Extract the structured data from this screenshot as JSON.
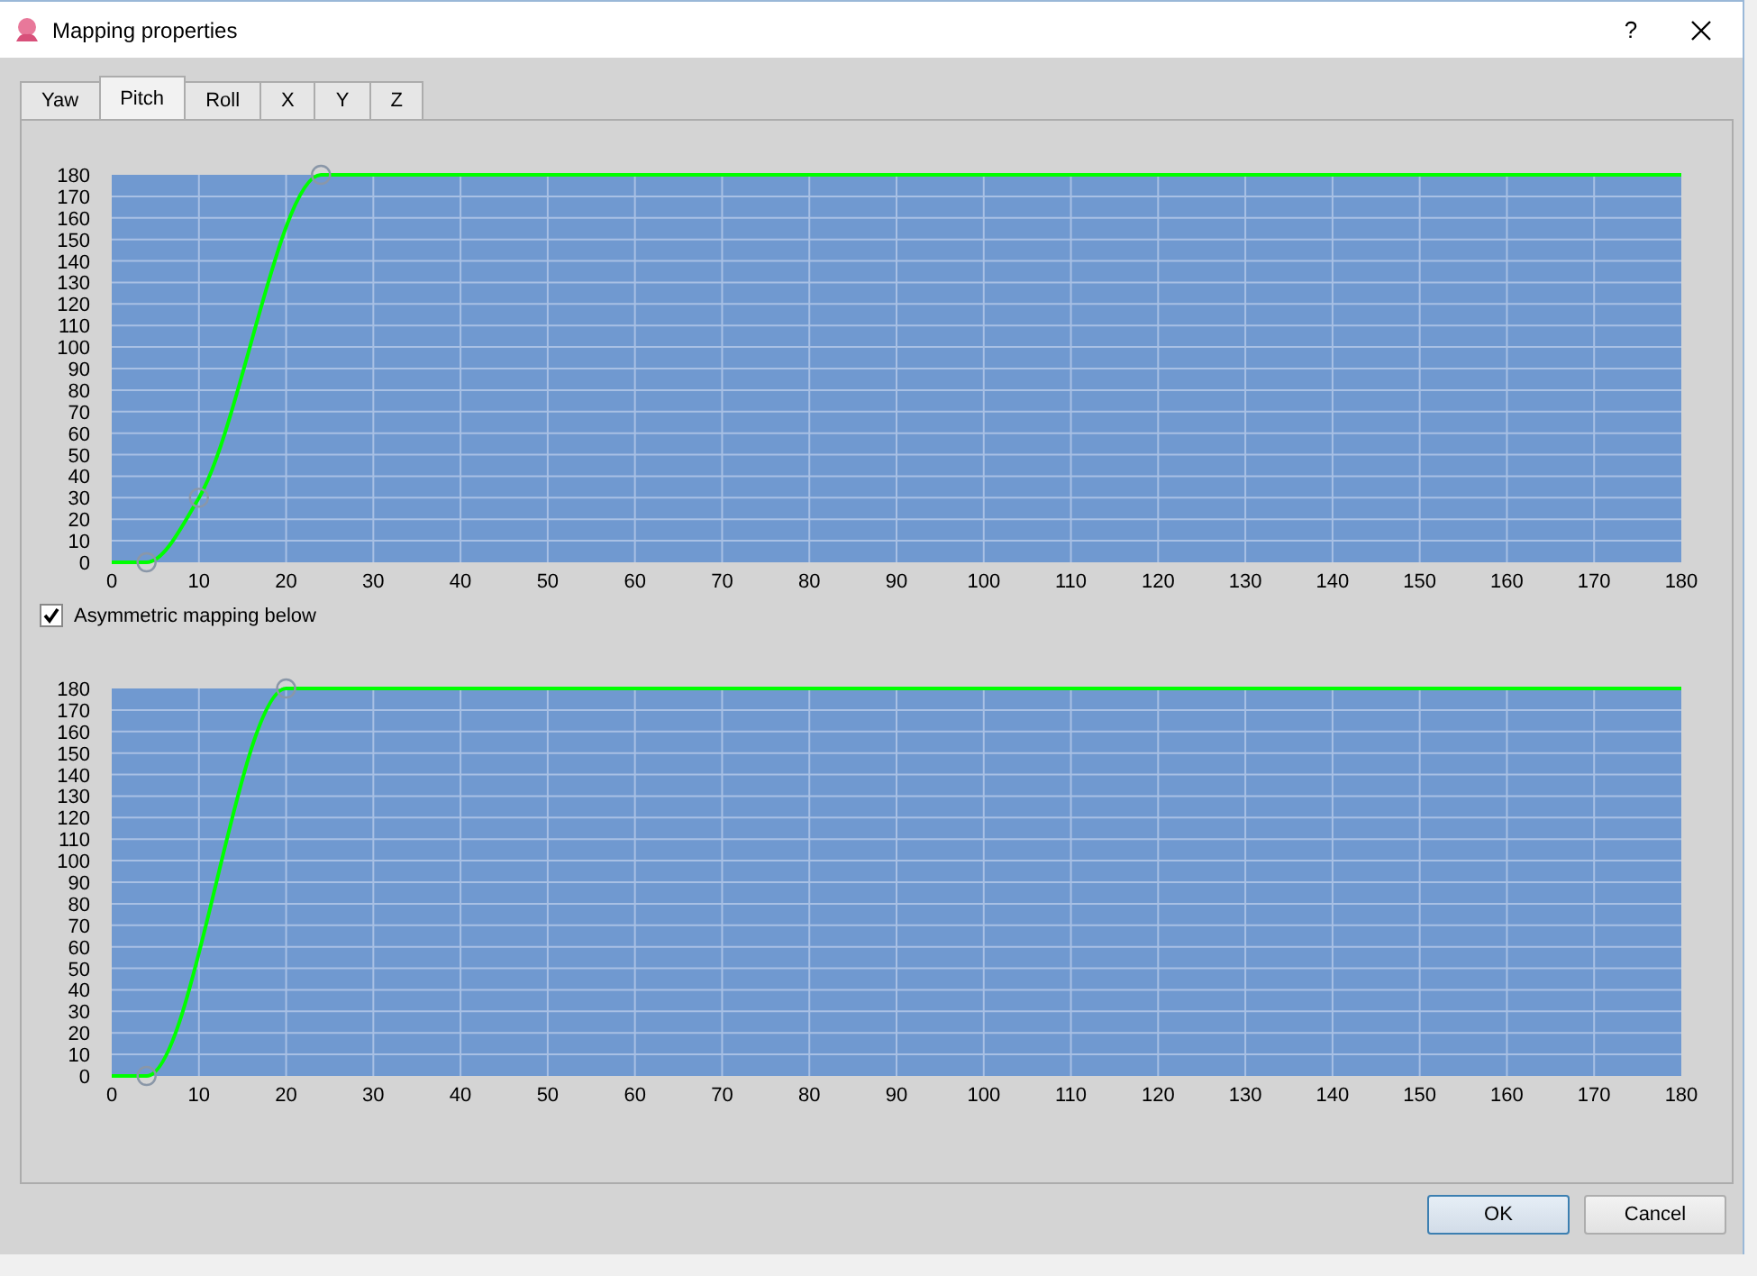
{
  "window": {
    "title": "Mapping properties",
    "help": "?"
  },
  "tabs": [
    {
      "label": "Yaw",
      "selected": false
    },
    {
      "label": "Pitch",
      "selected": true
    },
    {
      "label": "Roll",
      "selected": false
    },
    {
      "label": "X",
      "selected": false
    },
    {
      "label": "Y",
      "selected": false
    },
    {
      "label": "Z",
      "selected": false
    }
  ],
  "upper_mapping": {
    "chart_data": {
      "type": "line",
      "x": [
        0,
        4,
        10,
        24,
        180
      ],
      "series": [
        {
          "color": "#00ff00",
          "values": [
            0,
            0,
            30,
            180,
            180
          ]
        }
      ],
      "grid": true,
      "xlim": [
        0,
        180
      ],
      "ylim": [
        0,
        180
      ],
      "xticks": [
        0,
        10,
        20,
        30,
        40,
        50,
        60,
        70,
        80,
        90,
        100,
        110,
        120,
        130,
        140,
        150,
        160,
        170,
        180
      ],
      "yticks": [
        0,
        10,
        20,
        30,
        40,
        50,
        60,
        70,
        80,
        90,
        100,
        110,
        120,
        130,
        140,
        150,
        160,
        170,
        180
      ]
    }
  },
  "asymmetric": {
    "label": "Asymmetric mapping below",
    "checked": true
  },
  "lower_mapping": {
    "chart_data": {
      "type": "line",
      "x": [
        0,
        4,
        20,
        180
      ],
      "series": [
        {
          "color": "#00ff00",
          "values": [
            0,
            0,
            180,
            180
          ]
        }
      ],
      "grid": true,
      "xlim": [
        0,
        180
      ],
      "ylim": [
        0,
        180
      ],
      "xticks": [
        0,
        10,
        20,
        30,
        40,
        50,
        60,
        70,
        80,
        90,
        100,
        110,
        120,
        130,
        140,
        150,
        160,
        170,
        180
      ],
      "yticks": [
        0,
        10,
        20,
        30,
        40,
        50,
        60,
        70,
        80,
        90,
        100,
        110,
        120,
        130,
        140,
        150,
        160,
        170,
        180
      ]
    }
  },
  "buttons": [
    {
      "label": "OK",
      "default": true
    },
    {
      "label": "Cancel",
      "default": false
    }
  ]
}
